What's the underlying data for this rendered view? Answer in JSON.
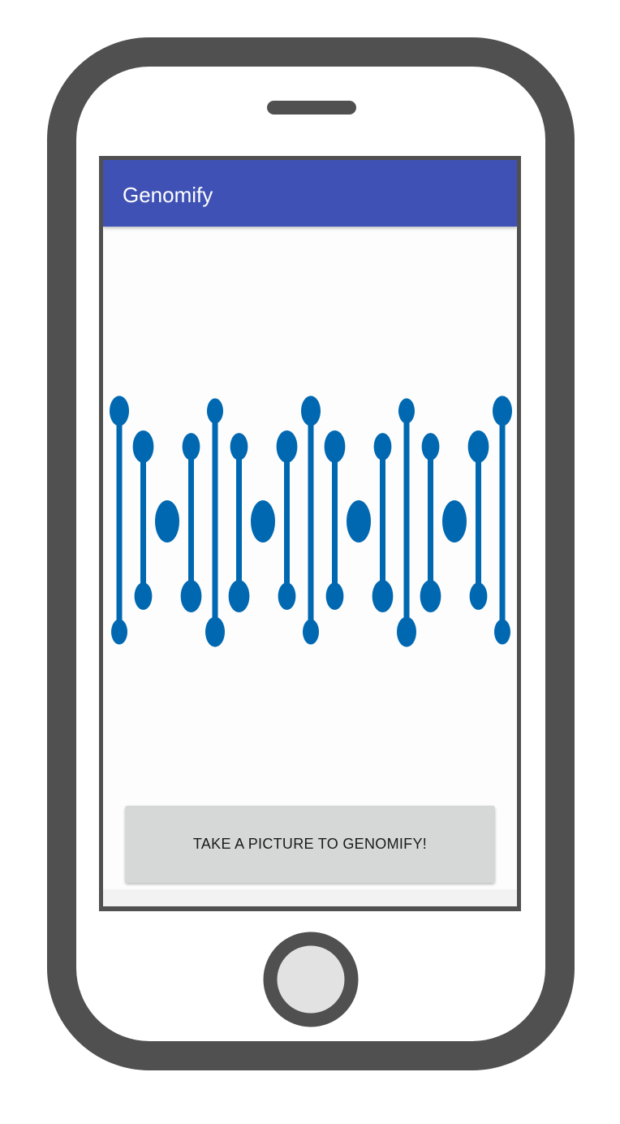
{
  "app": {
    "title": "Genomify"
  },
  "main": {
    "action_label": "TAKE A PICTURE TO GENOMIFY!"
  },
  "colors": {
    "app_bar": "#3f51b5",
    "dna": "#0068b1",
    "phone_body": "#505050",
    "button": "#d6d7d7"
  },
  "icons": {
    "hero": "dna-helix-icon",
    "home": "home-button-icon",
    "speaker": "speaker-icon"
  }
}
